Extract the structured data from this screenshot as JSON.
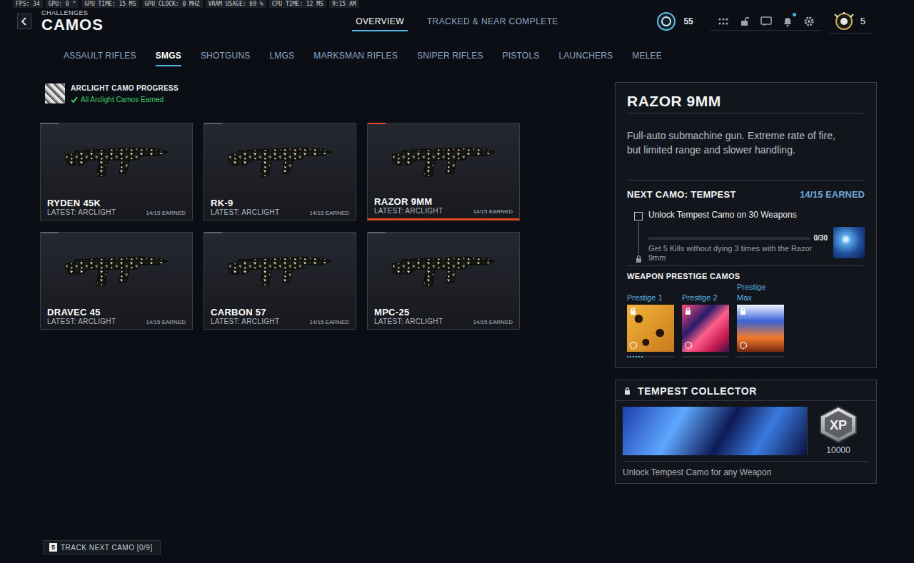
{
  "overlay_stats": [
    "FPS: 34",
    "GPU: 0 °",
    "GPU TIME: 15 MS",
    "GPU CLOCK: 0 MHZ",
    "VRAM USAGE: 69 %",
    "CPU TIME: 12 MS",
    "9:15 AM"
  ],
  "header": {
    "subtitle": "CHALLENGES",
    "title": "CAMOS"
  },
  "nav_tabs": [
    {
      "label": "OVERVIEW",
      "selected": true
    },
    {
      "label": "TRACKED & NEAR COMPLETE",
      "selected": false
    }
  ],
  "player": {
    "level": "55",
    "prestige": "5",
    "notification": true
  },
  "categories": [
    {
      "label": "ASSAULT RIFLES",
      "selected": false
    },
    {
      "label": "SMGS",
      "selected": true
    },
    {
      "label": "SHOTGUNS",
      "selected": false
    },
    {
      "label": "LMGS",
      "selected": false
    },
    {
      "label": "MARKSMAN RIFLES",
      "selected": false
    },
    {
      "label": "SNIPER RIFLES",
      "selected": false
    },
    {
      "label": "PISTOLS",
      "selected": false
    },
    {
      "label": "LAUNCHERS",
      "selected": false
    },
    {
      "label": "MELEE",
      "selected": false
    }
  ],
  "camo_progress": {
    "title": "ARCLIGHT CAMO PROGRESS",
    "status": "All Arclight Camos Earned",
    "complete": true
  },
  "weapons": [
    {
      "name": "RYDEN 45K",
      "latest": "LATEST: ARCLIGHT",
      "earned": "14/15 EARNED",
      "level": 0.12,
      "selected": false
    },
    {
      "name": "RK-9",
      "latest": "LATEST: ARCLIGHT",
      "earned": "14/15 EARNED",
      "level": 0.12,
      "selected": false
    },
    {
      "name": "RAZOR 9MM",
      "latest": "LATEST: ARCLIGHT",
      "earned": "14/15 EARNED",
      "level": 0.12,
      "selected": true
    },
    {
      "name": "DRAVEC 45",
      "latest": "LATEST: ARCLIGHT",
      "earned": "14/15 EARNED",
      "level": 0.12,
      "selected": false
    },
    {
      "name": "CARBON 57",
      "latest": "LATEST: ARCLIGHT",
      "earned": "14/15 EARNED",
      "level": 0.12,
      "selected": false
    },
    {
      "name": "MPC-25",
      "latest": "LATEST: ARCLIGHT",
      "earned": "14/15 EARNED",
      "level": 0.12,
      "selected": false
    }
  ],
  "detail": {
    "name": "RAZOR 9MM",
    "description": "Full-auto submachine gun. Extreme rate of fire, but limited range and slower handling.",
    "next_camo": "NEXT CAMO: TEMPEST",
    "earned": "14/15 EARNED",
    "challenge": {
      "title": "Unlock Tempest Camo on 30 Weapons",
      "checked": false,
      "count": "0/30",
      "level": 0,
      "locked": true,
      "description": "Get 5 Kills without dying 3 times with the Razor 9mm"
    },
    "prestige_title": "WEAPON PRESTIGE CAMOS",
    "prestige_camos": [
      {
        "label": "Prestige 1",
        "locked": true,
        "level": 0.35
      },
      {
        "label": "Prestige 2",
        "locked": true,
        "level": 0
      },
      {
        "label": "Prestige Max",
        "locked": true,
        "level": 0
      }
    ]
  },
  "collector": {
    "title": "TEMPEST COLLECTOR",
    "locked": true,
    "badge": "XP",
    "reward": "10000",
    "description": "Unlock Tempest Camo for any Weapon"
  },
  "track_button": {
    "key": "5",
    "label": "TRACK NEXT CAMO [0/9]"
  }
}
